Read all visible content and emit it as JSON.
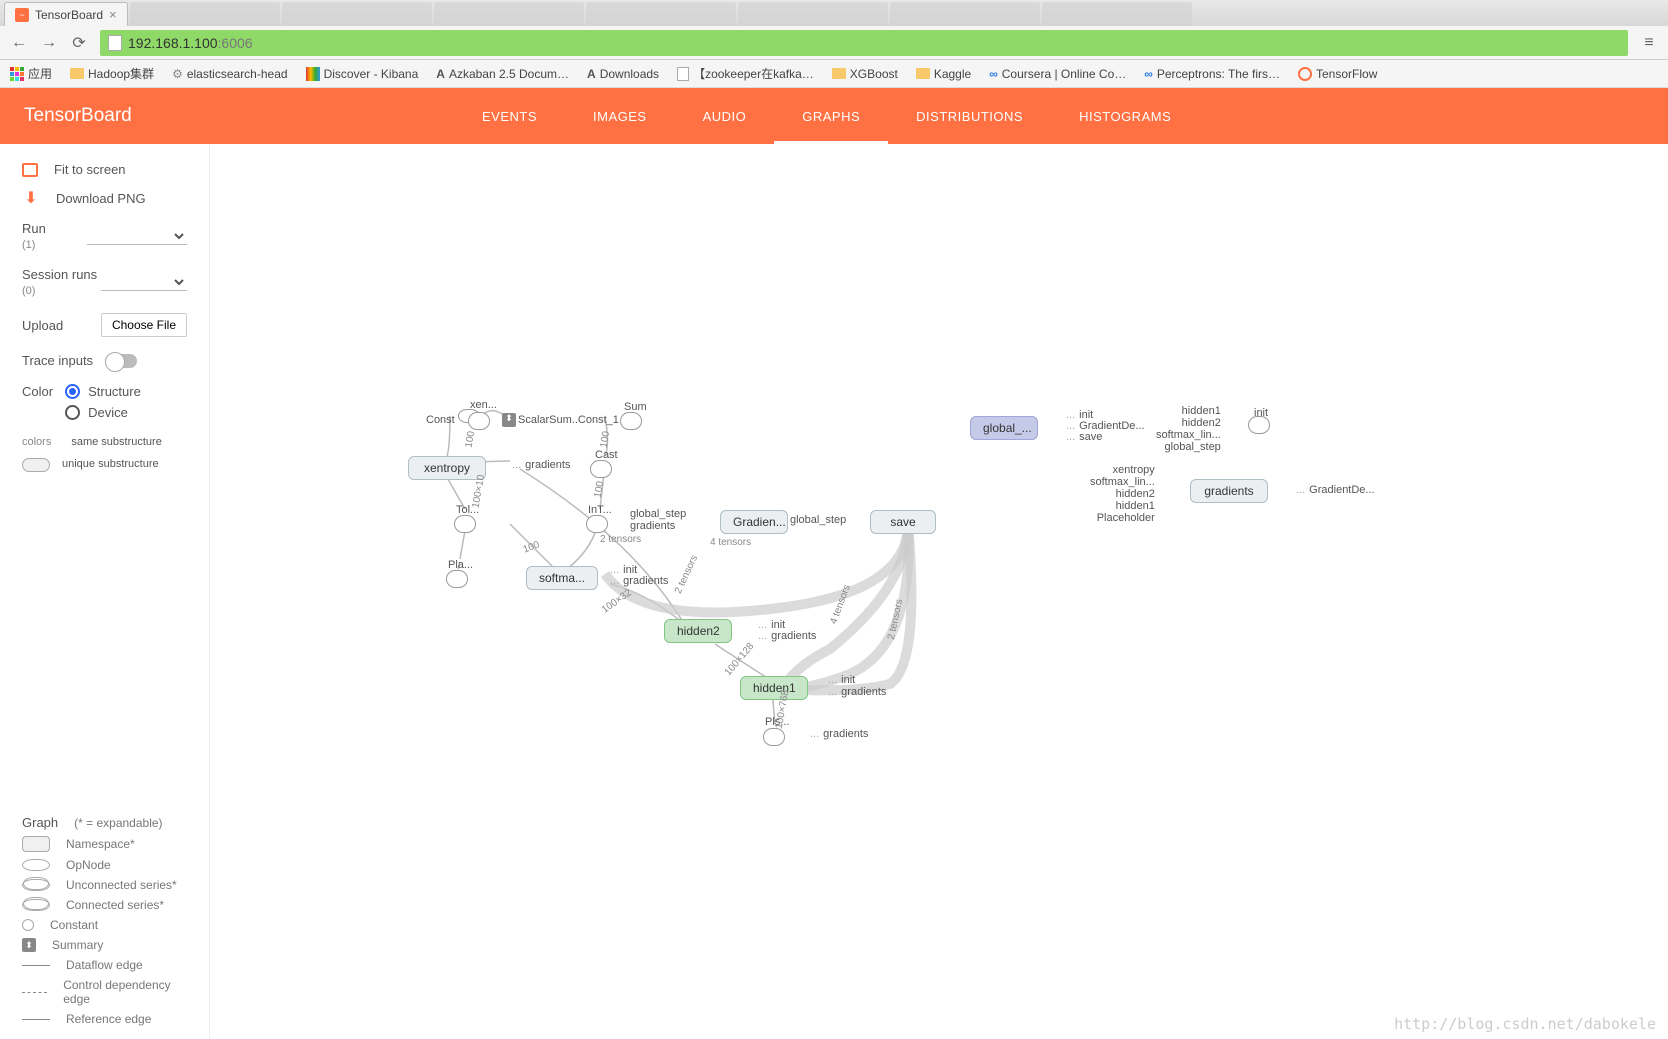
{
  "browser": {
    "tab_title": "TensorBoard",
    "url": "192.168.1.100:6006",
    "url_port_highlight": "6006",
    "bookmarks": {
      "apps": "应用",
      "items": [
        "Hadoop集群",
        "elasticsearch-head",
        "Discover - Kibana",
        "Azkaban 2.5 Docum…",
        "Downloads",
        "【zookeeper在kafka…",
        "XGBoost",
        "Kaggle",
        "Coursera | Online Co…",
        "Perceptrons: The firs…",
        "TensorFlow"
      ]
    }
  },
  "header": {
    "brand": "TensorBoard",
    "tabs": [
      "EVENTS",
      "IMAGES",
      "AUDIO",
      "GRAPHS",
      "DISTRIBUTIONS",
      "HISTOGRAMS"
    ],
    "active_tab": "GRAPHS"
  },
  "sidebar": {
    "fit": "Fit to screen",
    "download": "Download PNG",
    "run_label": "Run",
    "run_count": "(1)",
    "session_label": "Session runs",
    "session_count": "(0)",
    "upload_label": "Upload",
    "choose_file": "Choose File",
    "trace": "Trace inputs",
    "color_label": "Color",
    "color_structure": "Structure",
    "color_device": "Device",
    "colors_label": "colors",
    "same_sub": "same substructure",
    "unique_sub": "unique substructure",
    "legend": {
      "graph_label": "Graph",
      "expandable": "(* = expandable)",
      "namespace": "Namespace*",
      "opnode": "OpNode",
      "unconnected": "Unconnected series*",
      "connected": "Connected series*",
      "constant": "Constant",
      "summary": "Summary",
      "dataflow": "Dataflow edge",
      "control": "Control dependency edge",
      "reference": "Reference edge"
    }
  },
  "graph": {
    "nodes": {
      "const": "Const",
      "xen": "xen...",
      "scalar": "ScalarSum..Const_1",
      "sum": "Sum",
      "xentropy": "xentropy",
      "gradients_small": "gradients",
      "cast": "Cast",
      "tol": "Tol...",
      "int": "InT...",
      "pla": "Pla...",
      "softma": "softma...",
      "gradien": "Gradien...",
      "global_step": "global_step",
      "save": "save",
      "hidden2": "hidden2",
      "hidden1": "hidden1",
      "pls": "Pls...",
      "gradients_pls": "gradients",
      "init_h2": "init",
      "grad_h2": "gradients",
      "init_h1": "init",
      "grad_h1": "gradients",
      "init_sm": "init",
      "grad_sm": "gradients",
      "gs_grad": "global_step",
      "gs_grad2": "gradients",
      "tensors2": "2 tensors",
      "tensors4": "4 tensors",
      "global_node": "global_...",
      "gn_init": "init",
      "gn_grad": "GradientDe...",
      "gn_save": "save",
      "gradients_node": "gradients",
      "gradde": "GradientDe...",
      "gr_xentropy": "xentropy",
      "gr_softmax": "softmax_lin...",
      "gr_hidden2": "hidden2",
      "gr_hidden1": "hidden1",
      "gr_placeholder": "Placeholder",
      "init_right": "init",
      "ir_hidden1": "hidden1",
      "ir_hidden2": "hidden2",
      "ir_softmax": "softmax_lin...",
      "ir_global": "global_step"
    },
    "edge_labels": {
      "e100": "100",
      "e100x10": "100×10",
      "e100x32": "100×32",
      "e100x128": "100×128",
      "e100x768": "100×768",
      "tensors2b": "2 tensors",
      "tensors4b": "4 tensors"
    }
  },
  "watermark": "http://blog.csdn.net/dabokele"
}
